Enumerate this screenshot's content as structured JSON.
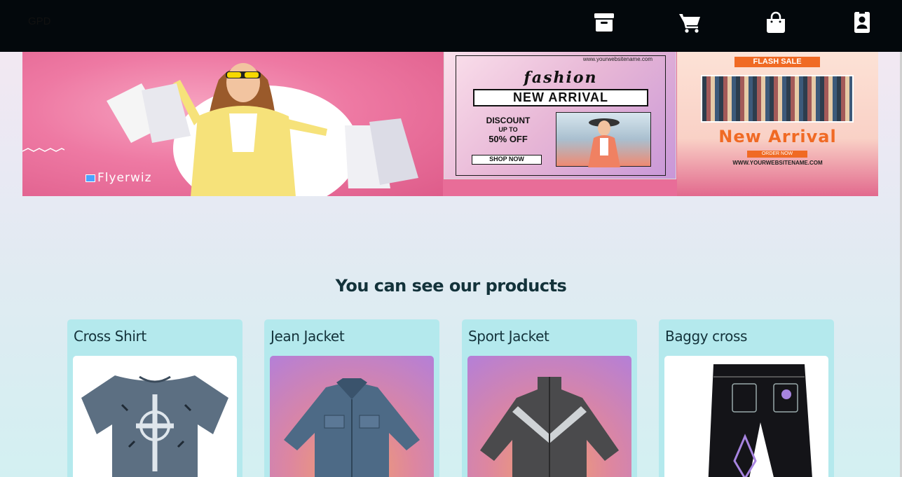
{
  "navbar": {
    "brand": "GPD",
    "icons": [
      "archive-icon",
      "cart-icon",
      "shopping-bag-icon",
      "contact-icon"
    ],
    "background": "#03080c"
  },
  "banner": {
    "brand_logo_text": "Flyerwiz",
    "flyer_mid": {
      "url": "www.yourwebsitename.com",
      "title": "fashion",
      "badge": "NEW ARRIVAL",
      "discount_line1": "DISCOUNT",
      "discount_line2": "UP TO",
      "discount_line3": "50% OFF",
      "button": "SHOP NOW"
    },
    "flyer_right": {
      "tag": "FLASH SALE",
      "headline": "New Arrival",
      "button": "ORDER NOW",
      "url": "WWW.YOURWEBSITENAME.COM"
    }
  },
  "products": {
    "heading": "You can see our products",
    "items": [
      {
        "title": "Cross Shirt",
        "image": "shirt-image"
      },
      {
        "title": "Jean Jacket",
        "image": "jacket-image"
      },
      {
        "title": "Sport Jacket",
        "image": "sport-jacket-image"
      },
      {
        "title": "Baggy cross",
        "image": "jeans-image"
      }
    ],
    "card_color": "#b4e9ed",
    "title_color": "#13323a"
  }
}
